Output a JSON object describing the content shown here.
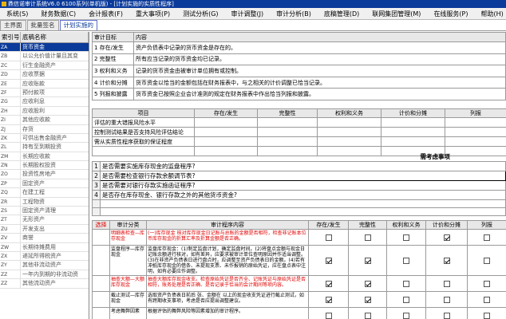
{
  "window": {
    "title": "鼎信诺审计系统V6.0 6100系列(单机版) - [计划实施的实质性程序]"
  },
  "menu": [
    "系统(S)",
    "财务数据(C)",
    "会计报表(F)",
    "重大事项(P)",
    "测试分析(G)",
    "审计调整(J)",
    "审计分析(B)",
    "底稿管理(D)",
    "联网集团管理(M)",
    "在线服务(P)",
    "帮助(H)"
  ],
  "tabs": [
    {
      "label": "主界面",
      "active": false
    },
    {
      "label": "批量签名",
      "active": false
    },
    {
      "label": "计划实施的",
      "active": true
    }
  ],
  "left_panel": {
    "headers": [
      "索引号",
      "底稿名称"
    ],
    "rows": [
      {
        "code": "ZA",
        "name": "货币资金",
        "active": true
      },
      {
        "code": "ZB",
        "name": "以公允价值计量且其变",
        "active": false
      },
      {
        "code": "ZC",
        "name": "衍生金融资产",
        "active": false
      },
      {
        "code": "ZD",
        "name": "应收票据",
        "active": false
      },
      {
        "code": "ZE",
        "name": "应收账款",
        "active": false
      },
      {
        "code": "ZF",
        "name": "预付款项",
        "active": false
      },
      {
        "code": "ZG",
        "name": "应收利息",
        "active": false
      },
      {
        "code": "ZH",
        "name": "应收股利",
        "active": false
      },
      {
        "code": "ZI",
        "name": "其他应收款",
        "active": false
      },
      {
        "code": "ZJ",
        "name": "存货",
        "active": false
      },
      {
        "code": "ZK",
        "name": "可供出售金融资产",
        "active": false
      },
      {
        "code": "ZL",
        "name": "持有至到期投资",
        "active": false
      },
      {
        "code": "ZM",
        "name": "长期应收款",
        "active": false
      },
      {
        "code": "ZN",
        "name": "长期股权投资",
        "active": false
      },
      {
        "code": "ZO",
        "name": "投资性房地产",
        "active": false
      },
      {
        "code": "ZP",
        "name": "固定资产",
        "active": false
      },
      {
        "code": "ZQ",
        "name": "在建工程",
        "active": false
      },
      {
        "code": "ZR",
        "name": "工程物资",
        "active": false
      },
      {
        "code": "ZS",
        "name": "固定资产清理",
        "active": false
      },
      {
        "code": "ZT",
        "name": "无形资产",
        "active": false
      },
      {
        "code": "ZU",
        "name": "开发支出",
        "active": false
      },
      {
        "code": "ZV",
        "name": "商誉",
        "active": false
      },
      {
        "code": "ZW",
        "name": "长期待摊费用",
        "active": false
      },
      {
        "code": "ZX",
        "name": "递延所得税资产",
        "active": false
      },
      {
        "code": "ZY",
        "name": "其他非流动资产",
        "active": false
      },
      {
        "code": "ZZ",
        "name": "一年内到期的非流动资",
        "active": false
      },
      {
        "code": "ZZ",
        "name": "其他流动资产",
        "active": false
      }
    ]
  },
  "goals": {
    "headers": [
      "审计目标",
      "内容"
    ],
    "rows": [
      {
        "goal": "1 存在/发生",
        "content": "资产负债表中记录的货币资金是存在的。"
      },
      {
        "goal": "2 完整性",
        "content": "所有应当记录的货币资金均已记录。"
      },
      {
        "goal": "3 权利和义务",
        "content": "记录的货币资金由被审计单位拥有或控制。"
      },
      {
        "goal": "4 计价和分摊",
        "content": "货币资金以恰当的金额包括在财务报表中，与之相关的计价调整已恰当记录。"
      },
      {
        "goal": "5 列报和披露",
        "content": "货币资金已按照企业会计准则的规定在财务报表中作出恰当列报和披露。"
      }
    ]
  },
  "assessment": {
    "headers": [
      "项目",
      "存在/发生",
      "完整性",
      "权利和义务",
      "计价和分摊",
      "列报"
    ],
    "rows": [
      "评估的重大错报风险水平",
      "控制测试结果是否支持风险评估结论",
      "需从实质性程序获取的保证程度"
    ]
  },
  "issues": {
    "title": "需考虑事项",
    "rows": [
      {
        "num": "1",
        "text": "是否需要实施库存现金的监盘程序?",
        "selected": false
      },
      {
        "num": "2",
        "text": "是否需要检查银行存款余额调节表?",
        "selected": true
      },
      {
        "num": "3",
        "text": "是否需要对银行存款实施函证程序?",
        "selected": false
      },
      {
        "num": "4",
        "text": "是否存在库存现金、银行存款之外的其他货币资金?",
        "selected": false
      }
    ]
  },
  "procedures": {
    "headers": [
      "选择",
      "审计分类",
      "审计程序内容",
      "存在/发生",
      "完整性",
      "权利和义务",
      "计价和分摊",
      "列报"
    ],
    "rows": [
      {
        "category": "明细表检查—库存现金",
        "content": "(一)库存现金\n核对库存现金日记账与总账的金额是否相符，检查非记账本位币库存现金的折算汇率及折算金额是否正确。",
        "red": true,
        "checks": [
          false,
          false,
          false,
          true,
          false
        ]
      },
      {
        "category": "监盘程序—库存现金",
        "content": "监盘库存现金：(1)制定监盘计划，确定监盘时间。(2)将盘点金额与现金日记账余额进行核对，如有差异，应要求被审计单位查明原因并作适当调整。(3)在非资产负债表日进行盘点时，应调整至资产负债表日的金额。(4)若有冲抵库存现金的借条、未提现支票、未作报销的原始凭证，应在盘点表中注明，如有必要应作调整。",
        "red": false,
        "checks": [
          true,
          true,
          false,
          true,
          false
        ]
      },
      {
        "category": "抽查大额—大额库存现金",
        "content": "抽查大额库存现金收支。检查原始凭证是否齐全、记账凭证与原始凭证是否相符，账务处理是否正确、是否记录于恰当的会计期间等项内容。",
        "red": true,
        "checks": [
          true,
          true,
          false,
          false,
          false
        ]
      },
      {
        "category": "截止测试—库存现金",
        "content": "选取资产负债表日前后     张、金额在     以上的现金收支凭证进行截止测试，如有跨期收支事项，考虑是否应提出调整建议。",
        "red": false,
        "checks": [
          true,
          true,
          false,
          false,
          false
        ]
      },
      {
        "category": "考虑舞弊因素",
        "content": "根据评估的舞弊风险等因素增加的审计程序。",
        "red": false,
        "checks": [
          false,
          false,
          false,
          false,
          false
        ]
      }
    ]
  }
}
